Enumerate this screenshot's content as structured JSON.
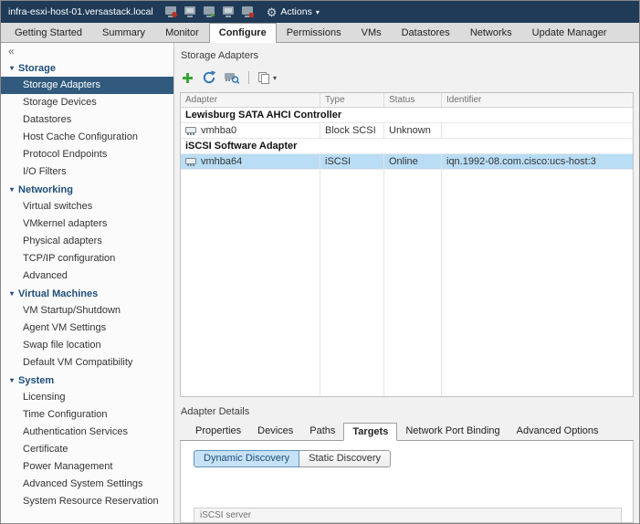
{
  "topbar": {
    "host_name": "infra-esxi-host-01.versastack.local",
    "actions_label": "Actions"
  },
  "icons": {
    "collapse": "«",
    "chevron_down": "▾",
    "gear": "⚙",
    "caret_down": "▾"
  },
  "tabs": [
    {
      "label": "Getting Started"
    },
    {
      "label": "Summary"
    },
    {
      "label": "Monitor"
    },
    {
      "label": "Configure",
      "active": true
    },
    {
      "label": "Permissions"
    },
    {
      "label": "VMs"
    },
    {
      "label": "Datastores"
    },
    {
      "label": "Networks"
    },
    {
      "label": "Update Manager"
    }
  ],
  "sidebar": {
    "selected_item": "Storage Adapters",
    "sections": [
      {
        "label": "Storage",
        "items": [
          "Storage Adapters",
          "Storage Devices",
          "Datastores",
          "Host Cache Configuration",
          "Protocol Endpoints",
          "I/O Filters"
        ]
      },
      {
        "label": "Networking",
        "items": [
          "Virtual switches",
          "VMkernel adapters",
          "Physical adapters",
          "TCP/IP configuration",
          "Advanced"
        ]
      },
      {
        "label": "Virtual Machines",
        "items": [
          "VM Startup/Shutdown",
          "Agent VM Settings",
          "Swap file location",
          "Default VM Compatibility"
        ]
      },
      {
        "label": "System",
        "items": [
          "Licensing",
          "Time Configuration",
          "Authentication Services",
          "Certificate",
          "Power Management",
          "Advanced System Settings",
          "System Resource Reservation"
        ]
      }
    ]
  },
  "main": {
    "title": "Storage Adapters",
    "table": {
      "columns": [
        "Adapter",
        "Type",
        "Status",
        "Identifier"
      ],
      "rows": [
        {
          "kind": "group",
          "label": "Lewisburg SATA AHCI Controller"
        },
        {
          "kind": "adapter",
          "adapter": "vmhba0",
          "type": "Block SCSI",
          "status": "Unknown",
          "identifier": ""
        },
        {
          "kind": "group",
          "label": "iSCSI Software Adapter"
        },
        {
          "kind": "adapter",
          "adapter": "vmhba64",
          "type": "iSCSI",
          "status": "Online",
          "identifier": "iqn.1992-08.com.cisco:ucs-host:3",
          "selected": true
        }
      ]
    }
  },
  "details": {
    "title": "Adapter Details",
    "tabs": [
      "Properties",
      "Devices",
      "Paths",
      "Targets",
      "Network Port Binding",
      "Advanced Options"
    ],
    "active_tab": "Targets",
    "discovery_modes": [
      "Dynamic Discovery",
      "Static Discovery"
    ],
    "active_discovery": "Dynamic Discovery",
    "iscsi_server_header": "iSCSI server"
  },
  "colors": {
    "topbar_bg": "#1f3b57",
    "selected_nav_bg": "#315a7e",
    "selected_row_bg": "#b9ddf5",
    "section_header_text": "#1e4e79",
    "discovery_active_bg": "#c7e2f6"
  }
}
